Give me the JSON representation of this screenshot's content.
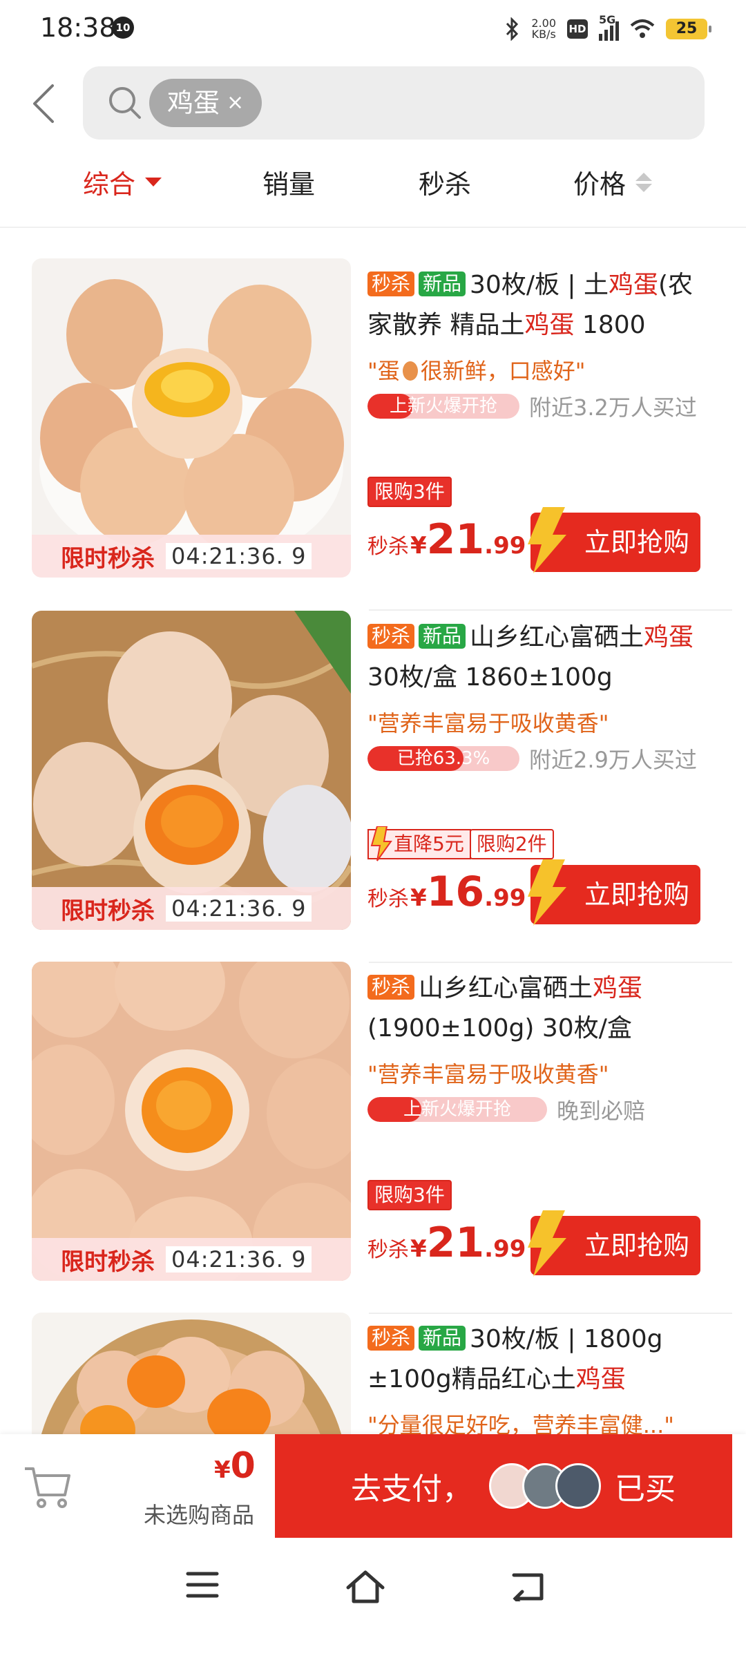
{
  "status_bar": {
    "time": "18:38",
    "notif_count": "10",
    "net_speed_value": "2.00",
    "net_speed_unit": "KB/s",
    "hd": "HD",
    "network": "5G",
    "battery": "25"
  },
  "search": {
    "chip_text": "鸡蛋",
    "chip_close": "×"
  },
  "tabs": [
    {
      "label": "综合",
      "active": true
    },
    {
      "label": "销量",
      "active": false
    },
    {
      "label": "秒杀",
      "active": false
    },
    {
      "label": "价格",
      "active": false
    }
  ],
  "products": [
    {
      "tags": [
        "秒杀",
        "新品"
      ],
      "title_parts": [
        "30枚/板 | 土",
        "鸡蛋",
        "(农家散养 精品土",
        "鸡蛋",
        " 1800"
      ],
      "quote_pre": "\"蛋",
      "quote_post": "很新鲜，口感好\"",
      "bar_text": "上新火爆开抢",
      "bar_fill": 0.3,
      "near_text": "附近3.2万人买过",
      "limit_text": "限购3件",
      "price_label": "秒杀",
      "currency": "¥",
      "price_int": "21",
      "price_dec": ".99",
      "buy_label": "立即抢购",
      "flash_label": "限时秒杀",
      "flash_time": "04:21:36. 9"
    },
    {
      "tags": [
        "秒杀",
        "新品"
      ],
      "title_parts": [
        "山乡红心富硒土",
        "鸡蛋",
        "30枚/盒 1860±100g"
      ],
      "quote": "\"营养丰富易于吸收黄香\"",
      "bar_text": "已抢63.3%",
      "bar_fill": 0.633,
      "near_text": "附近2.9万人买过",
      "drop_text": "直降5元",
      "limit_text": "限购2件",
      "price_label": "秒杀",
      "currency": "¥",
      "price_int": "16",
      "price_dec": ".99",
      "buy_label": "立即抢购",
      "flash_label": "限时秒杀",
      "flash_time": "04:21:36. 9"
    },
    {
      "tags": [
        "秒杀"
      ],
      "title_parts": [
        "山乡红心富硒土",
        "鸡蛋",
        "(1900±100g) 30枚/盒"
      ],
      "quote": "\"营养丰富易于吸收黄香\"",
      "bar_text": "上新火爆开抢",
      "bar_fill": 0.3,
      "near_text": "晚到必赔",
      "limit_text": "限购3件",
      "price_label": "秒杀",
      "currency": "¥",
      "price_int": "21",
      "price_dec": ".99",
      "buy_label": "立即抢购",
      "flash_label": "限时秒杀",
      "flash_time": "04:21:36. 9"
    },
    {
      "tags": [
        "秒杀",
        "新品"
      ],
      "title_parts": [
        "30枚/板 | 1800g ±100g精品红心土",
        "鸡蛋"
      ],
      "quote": "\"分量很足好吃，营养丰富健...\""
    }
  ],
  "cart": {
    "currency": "¥",
    "amount": "0",
    "empty_text": "未选购商品",
    "pay_label": "去支付，",
    "bought_label": "已买"
  },
  "colors": {
    "accent": "#d9261c",
    "tag_flash": "#f36b1d",
    "tag_new": "#28a745",
    "quote": "#e0641a"
  }
}
